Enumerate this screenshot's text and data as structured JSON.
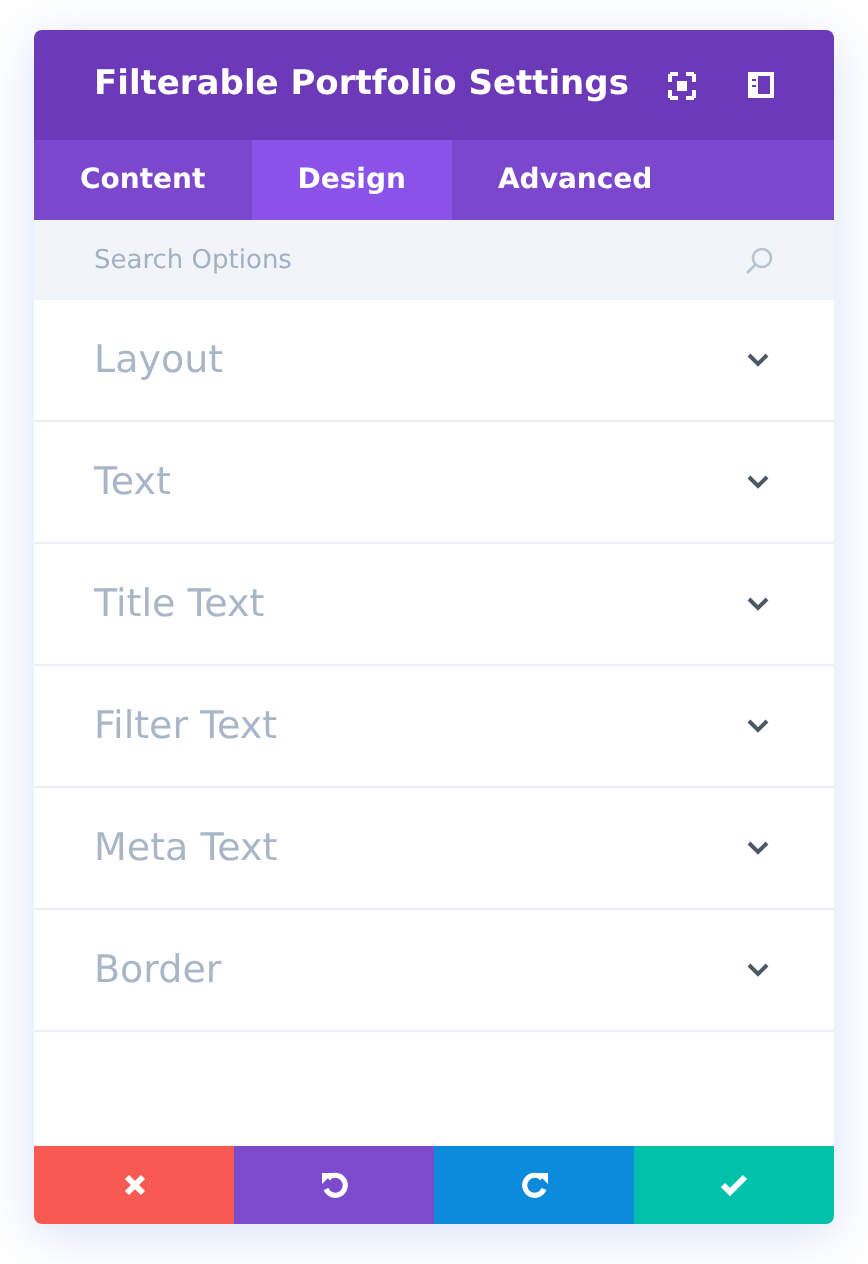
{
  "window": {
    "title": "Filterable Portfolio Settings"
  },
  "tabs": [
    {
      "label": "Content",
      "selected": false
    },
    {
      "label": "Design",
      "selected": true
    },
    {
      "label": "Advanced",
      "selected": false
    }
  ],
  "search": {
    "placeholder": "Search Options"
  },
  "sections": [
    {
      "label": "Layout",
      "expanded": false
    },
    {
      "label": "Text",
      "expanded": false
    },
    {
      "label": "Title Text",
      "expanded": false
    },
    {
      "label": "Filter Text",
      "expanded": false
    },
    {
      "label": "Meta Text",
      "expanded": false
    },
    {
      "label": "Border",
      "expanded": false
    }
  ],
  "footer_buttons": [
    {
      "kind": "discard"
    },
    {
      "kind": "undo"
    },
    {
      "kind": "redo"
    },
    {
      "kind": "save"
    }
  ]
}
